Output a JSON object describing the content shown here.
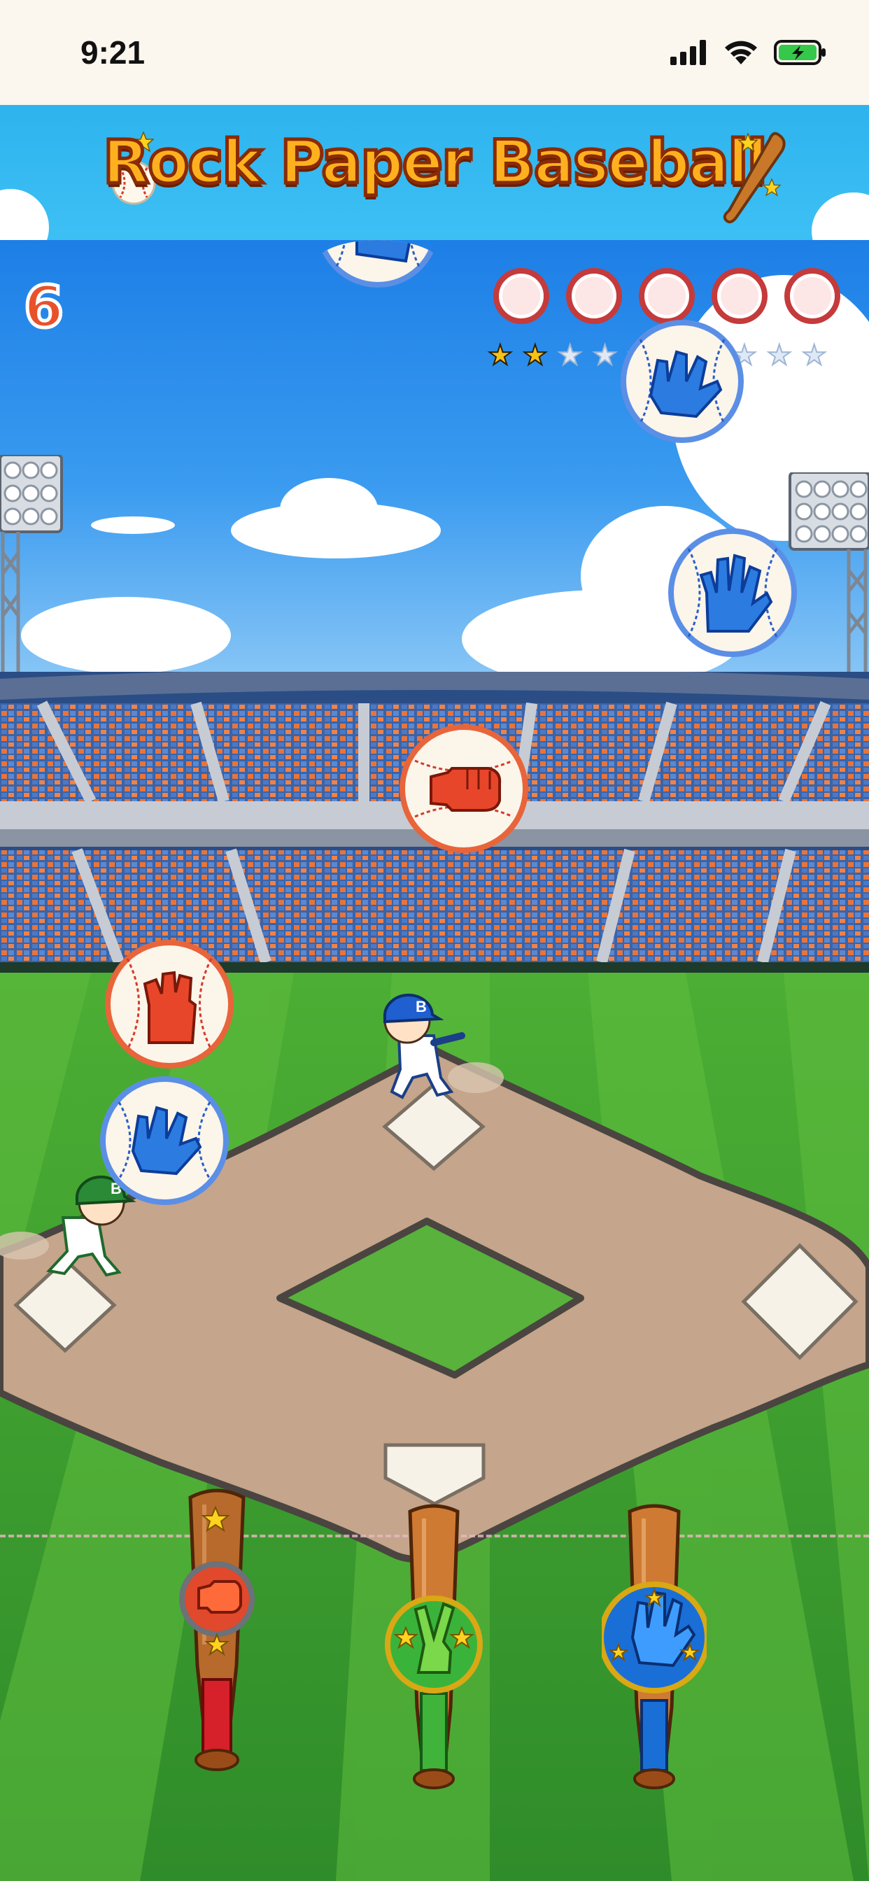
{
  "status_bar": {
    "time": "9:21",
    "icons": [
      "cellular-signal-icon",
      "wifi-icon",
      "battery-charging-icon"
    ]
  },
  "header": {
    "title": "Rock Paper Baseball",
    "icons": [
      "baseball-icon",
      "bat-icon",
      "star-icon"
    ]
  },
  "hud": {
    "score": "6",
    "lives_total": 5,
    "lives_remaining": 5,
    "stars_total": 10,
    "stars_earned": 2
  },
  "falling_balls": [
    {
      "type": "paper",
      "team": "blue"
    },
    {
      "type": "paper",
      "team": "blue"
    },
    {
      "type": "paper",
      "team": "blue"
    },
    {
      "type": "rock",
      "team": "red"
    },
    {
      "type": "rock",
      "team": "red"
    },
    {
      "type": "paper",
      "team": "blue"
    }
  ],
  "runners": [
    {
      "team": "blue",
      "cap_letter": "B"
    },
    {
      "team": "green",
      "cap_letter": "B"
    }
  ],
  "bats": [
    {
      "choice": "rock",
      "color": "#e0492b"
    },
    {
      "choice": "scissors",
      "color": "#3ab33a"
    },
    {
      "choice": "paper",
      "color": "#1a6fd6"
    }
  ],
  "colors": {
    "sky": "#2a8cea",
    "grass": "#3f9f32",
    "dirt": "#c4a68e",
    "title_fill": "#ffb01f",
    "score": "#e8522a"
  }
}
